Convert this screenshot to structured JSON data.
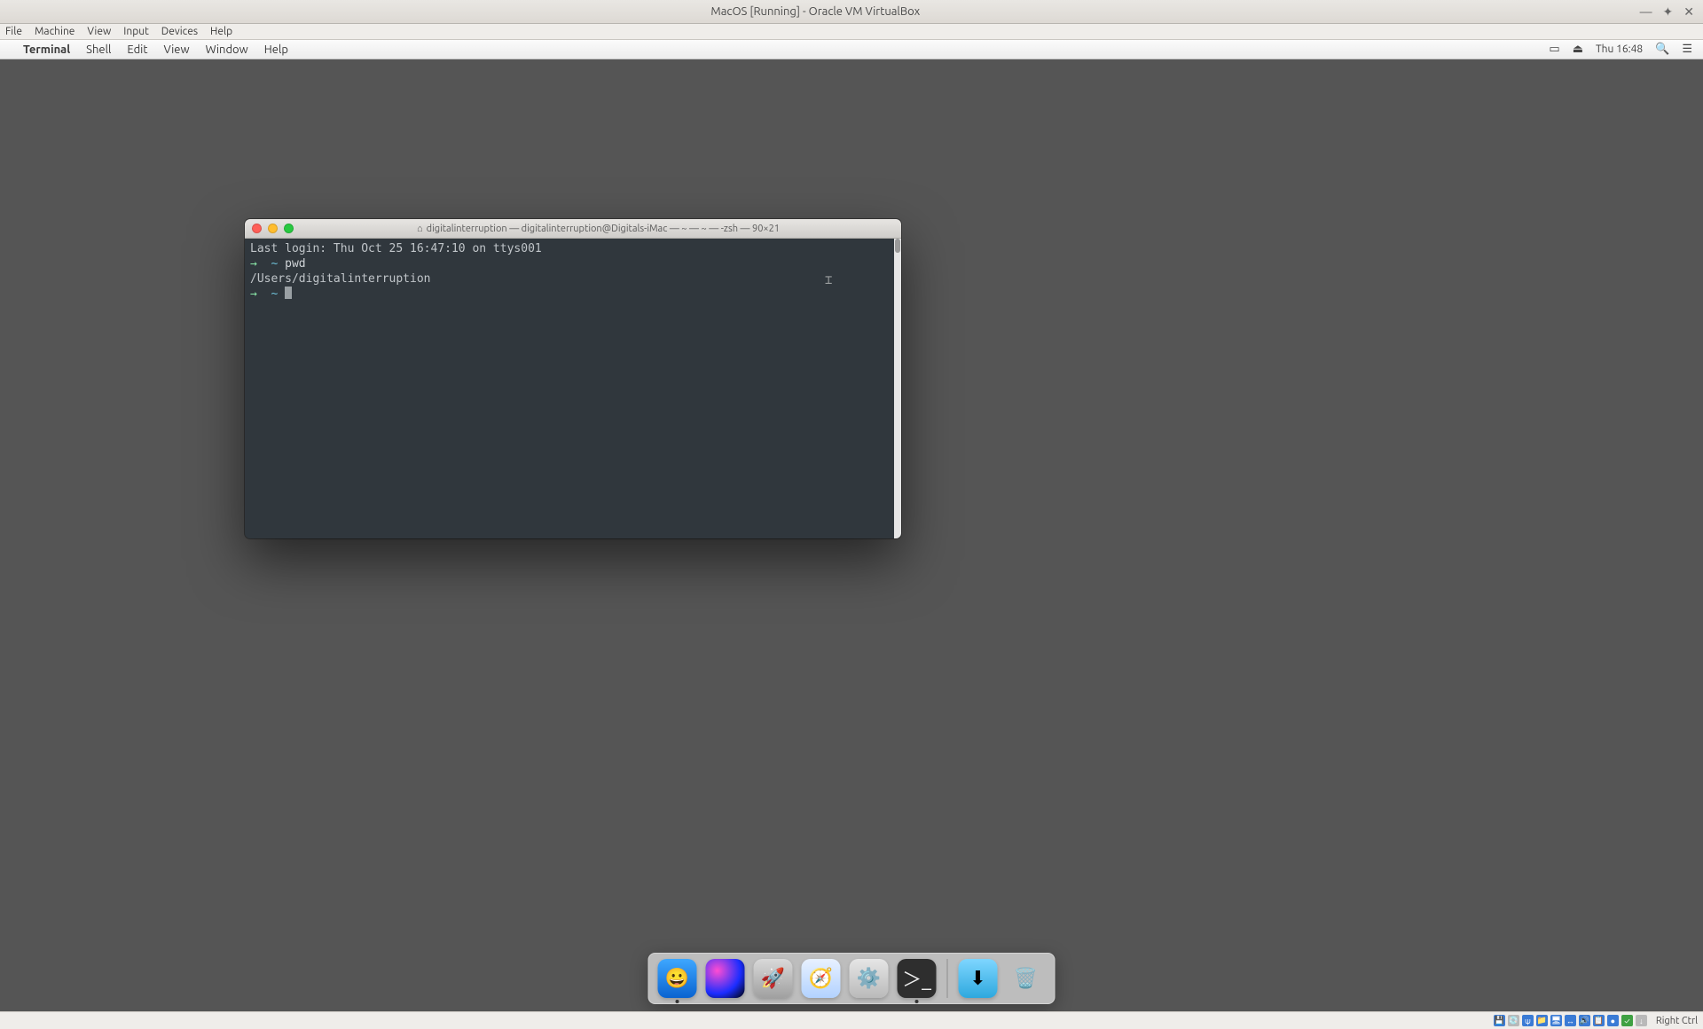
{
  "vbox": {
    "title": "MacOS [Running] - Oracle VM VirtualBox",
    "menu": {
      "file": "File",
      "machine": "Machine",
      "view": "View",
      "input": "Input",
      "devices": "Devices",
      "help": "Help"
    },
    "hostkey": "Right Ctrl"
  },
  "mac_menubar": {
    "app": "Terminal",
    "items": {
      "shell": "Shell",
      "edit": "Edit",
      "view": "View",
      "window": "Window",
      "help": "Help"
    },
    "clock": "Thu 16:48"
  },
  "terminal": {
    "title": "digitalinterruption — digitalinterruption@Digitals-iMac — ~ — ~ — -zsh — 90×21",
    "lines": {
      "last_login": "Last login: Thu Oct 25 16:47:10 on ttys001",
      "prompt1_arrow": "→",
      "prompt1_tilde": "~",
      "prompt1_cmd": "pwd",
      "pwd_output": "/Users/digitalinterruption",
      "prompt2_arrow": "→",
      "prompt2_tilde": "~"
    }
  },
  "dock": {
    "finder": "Finder",
    "siri": "Siri",
    "launchpad": "Launchpad",
    "safari": "Safari",
    "settings": "System Preferences",
    "terminal": "Terminal",
    "downloads": "Downloads",
    "trash": "Trash"
  }
}
